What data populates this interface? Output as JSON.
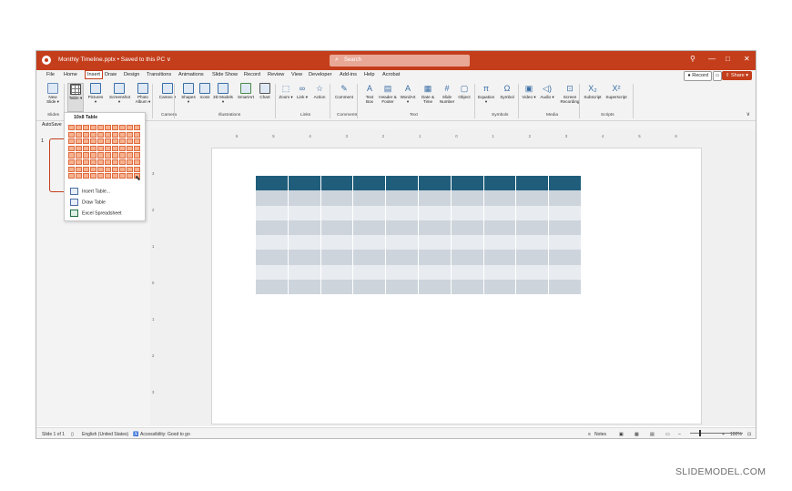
{
  "window": {
    "file_title": "Monthly Timeline.pptx • Saved to this PC ∨",
    "search_placeholder": "Search",
    "controls": {
      "minimize": "—",
      "restore": "□",
      "close": "✕"
    },
    "accent": "#c43e1c"
  },
  "tabs": [
    "File",
    "Home",
    "Insert",
    "Draw",
    "Design",
    "Transitions",
    "Animations",
    "Slide Show",
    "Record",
    "Review",
    "View",
    "Developer",
    "Add-ins",
    "Help",
    "Acrobat"
  ],
  "active_tab": "Insert",
  "record_label": "Record",
  "share_label": "Share",
  "ribbon": {
    "buttons": [
      {
        "id": "new-slide",
        "label": "New Slide ▾",
        "icon": "new-slide-icon"
      },
      {
        "id": "table",
        "label": "Table ▾",
        "icon": "table-icon"
      },
      {
        "id": "pictures",
        "label": "Pictures ▾",
        "icon": "pictures-icon"
      },
      {
        "id": "screenshot",
        "label": "Screenshot ▾",
        "icon": "screenshot-icon"
      },
      {
        "id": "photo-album",
        "label": "Photo Album ▾",
        "icon": "photo-album-icon"
      },
      {
        "id": "cameo",
        "label": "Cameo ▾",
        "icon": "cameo-icon"
      },
      {
        "id": "shapes",
        "label": "Shapes ▾",
        "icon": "shapes-icon"
      },
      {
        "id": "icons",
        "label": "Icons",
        "icon": "icons-icon"
      },
      {
        "id": "3d-models",
        "label": "3D Models ▾",
        "icon": "3d-models-icon"
      },
      {
        "id": "smartart",
        "label": "SmartArt",
        "icon": "smartart-icon"
      },
      {
        "id": "chart",
        "label": "Chart",
        "icon": "chart-icon"
      },
      {
        "id": "zoom",
        "label": "Zoom ▾",
        "icon": "zoom-icon"
      },
      {
        "id": "link",
        "label": "Link ▾",
        "icon": "link-icon"
      },
      {
        "id": "action",
        "label": "Action",
        "icon": "action-icon"
      },
      {
        "id": "comment",
        "label": "Comment",
        "icon": "comment-icon"
      },
      {
        "id": "text-box",
        "label": "Text Box",
        "icon": "text-box-icon"
      },
      {
        "id": "header-footer",
        "label": "Header & Footer",
        "icon": "header-footer-icon"
      },
      {
        "id": "wordart",
        "label": "WordArt ▾",
        "icon": "wordart-icon"
      },
      {
        "id": "date-time",
        "label": "Date & Time",
        "icon": "date-time-icon"
      },
      {
        "id": "slide-number",
        "label": "Slide Number",
        "icon": "slide-number-icon"
      },
      {
        "id": "object",
        "label": "Object",
        "icon": "object-icon"
      },
      {
        "id": "equation",
        "label": "Equation ▾",
        "icon": "equation-icon"
      },
      {
        "id": "symbol",
        "label": "Symbol",
        "icon": "symbol-icon"
      },
      {
        "id": "video",
        "label": "Video ▾",
        "icon": "video-icon"
      },
      {
        "id": "audio",
        "label": "Audio ▾",
        "icon": "audio-icon"
      },
      {
        "id": "screen-recording",
        "label": "Screen Recording",
        "icon": "screen-recording-icon"
      },
      {
        "id": "subscript",
        "label": "Subscript",
        "icon": "subscript-icon"
      },
      {
        "id": "superscript",
        "label": "Superscript",
        "icon": "superscript-icon"
      }
    ],
    "groups": [
      "Slides",
      "Camera",
      "Illustrations",
      "Links",
      "Comments",
      "Text",
      "Symbols",
      "Media",
      "Scripts"
    ],
    "icon_glyphs": {
      "zoom": "⬚",
      "link": "∞",
      "action": "☆",
      "comment": "✎",
      "equation": "π",
      "symbol": "Ω",
      "video": "▣",
      "audio": "◁)",
      "screen-recording": "⊡",
      "subscript": "X₂",
      "superscript": "X²",
      "wordart": "A",
      "text-box": "A",
      "header-footer": "▤",
      "date-time": "▦",
      "slide-number": "#",
      "object": "▢"
    }
  },
  "qat": {
    "autosave_label": "AutoSave",
    "autosave_state": "Off"
  },
  "table_dropdown": {
    "title": "10x8 Table",
    "grid_cols": 10,
    "grid_rows": 8,
    "selected_cols": 10,
    "selected_rows": 8,
    "items": [
      "Insert Table...",
      "Draw Table",
      "Excel Spreadsheet"
    ]
  },
  "slide_panel": {
    "slide_number": "1"
  },
  "ruler": {
    "h_ticks": [
      "6",
      "5",
      "4",
      "3",
      "2",
      "1",
      "0",
      "1",
      "2",
      "3",
      "4",
      "5",
      "6"
    ],
    "v_ticks": [
      "3",
      "2",
      "1",
      "0",
      "1",
      "2",
      "3"
    ]
  },
  "slide_table": {
    "cols": 10,
    "rows": 8,
    "header_color": "#1f5d7a",
    "band_dark": "#cdd4dc",
    "band_light": "#e8ecf0"
  },
  "status": {
    "slide_info": "Slide 1 of 1",
    "language": "English (United States)",
    "accessibility": "Accessibility: Good to go",
    "notes": "Notes",
    "zoom": "100%"
  },
  "watermark": "SLIDEMODEL.COM"
}
